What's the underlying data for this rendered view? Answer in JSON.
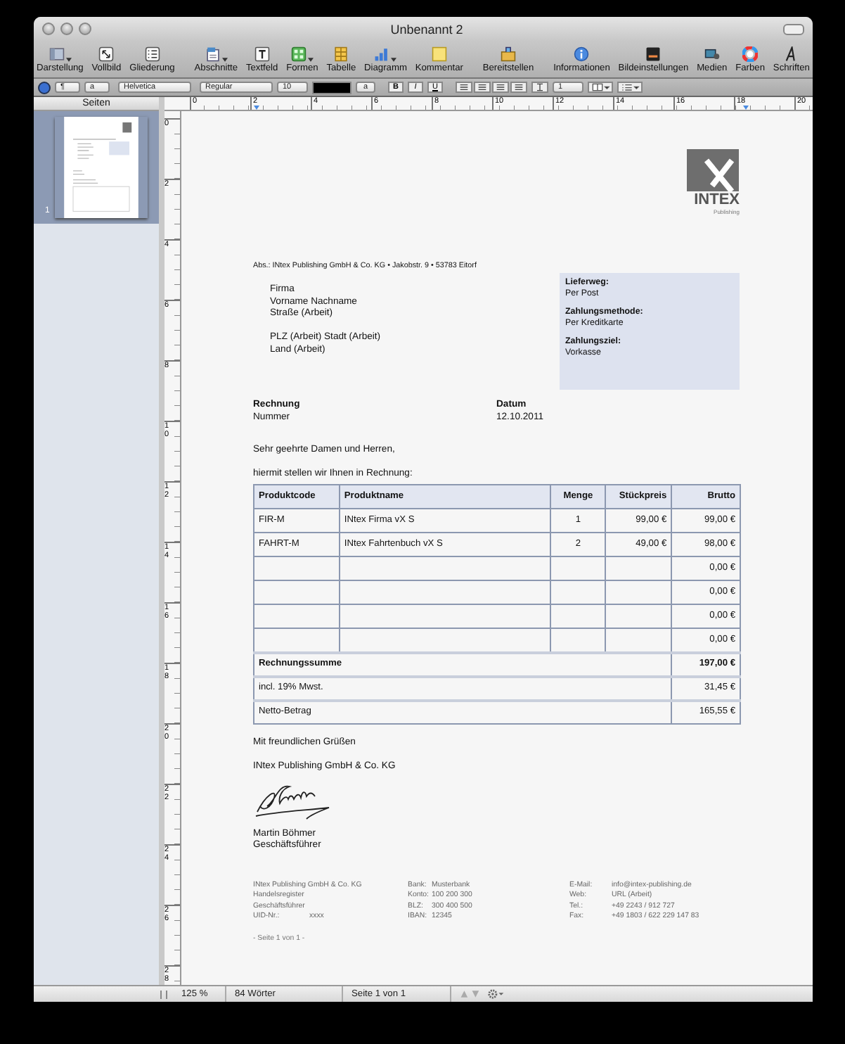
{
  "window": {
    "title": "Unbenannt 2"
  },
  "toolbar": {
    "items": [
      {
        "label": "Darstellung",
        "has_menu": true
      },
      {
        "label": "Vollbild",
        "has_menu": false
      },
      {
        "label": "Gliederung",
        "has_menu": false
      },
      {
        "label": "Abschnitte",
        "has_menu": true
      },
      {
        "label": "Textfeld",
        "has_menu": false
      },
      {
        "label": "Formen",
        "has_menu": true
      },
      {
        "label": "Tabelle",
        "has_menu": false
      },
      {
        "label": "Diagramm",
        "has_menu": true
      },
      {
        "label": "Kommentar",
        "has_menu": false
      },
      {
        "label": "Bereitstellen",
        "has_menu": false
      },
      {
        "label": "Informationen",
        "has_menu": false
      },
      {
        "label": "Bildeinstellungen",
        "has_menu": false
      },
      {
        "label": "Medien",
        "has_menu": false
      },
      {
        "label": "Farben",
        "has_menu": false
      },
      {
        "label": "Schriften",
        "has_menu": false
      }
    ]
  },
  "format_bar": {
    "paragraph_style": "¶",
    "character_style": "a",
    "font": "Helvetica",
    "typeface": "Regular",
    "size": "10",
    "highlight": "a",
    "styles": [
      "B",
      "I",
      "U"
    ],
    "line_spacing": "1"
  },
  "sidebar": {
    "title": "Seiten",
    "pages": [
      {
        "number": "1",
        "selected": true
      }
    ]
  },
  "ruler": {
    "horizontal": [
      "0",
      "2",
      "4",
      "6",
      "8",
      "10",
      "12",
      "14",
      "16",
      "18",
      "20"
    ],
    "vertical": [
      "0",
      "2",
      "4",
      "6",
      "8",
      "10",
      "12",
      "14",
      "16",
      "18",
      "20",
      "22",
      "24",
      "26",
      "28"
    ]
  },
  "document": {
    "logo": {
      "name": "INTEX",
      "tagline": "Publishing"
    },
    "sender_line": "Abs.: INtex Publishing GmbH & Co. KG • Jakobstr. 9 • 53783 Eitorf",
    "address": [
      [
        "Firma",
        "Vorname Nachname",
        "Straße (Arbeit)"
      ],
      [
        "PLZ (Arbeit) Stadt (Arbeit)",
        "Land (Arbeit)"
      ]
    ],
    "info_box": [
      {
        "label": "Lieferweg:",
        "value": "Per Post"
      },
      {
        "label": "Zahlungsmethode:",
        "value": "Per Kreditkarte"
      },
      {
        "label": "Zahlungsziel:",
        "value": "Vorkasse"
      }
    ],
    "invoice": {
      "label": "Rechnung",
      "value": "Nummer"
    },
    "date": {
      "label": "Datum",
      "value": "12.10.2011"
    },
    "salutation": "Sehr geehrte Damen und Herren,",
    "intro": "hiermit stellen wir Ihnen in Rechnung:",
    "table": {
      "columns": [
        "Produktcode",
        "Produktname",
        "Menge",
        "Stückpreis",
        "Brutto"
      ],
      "rows": [
        {
          "code": "FIR-M",
          "name": "INtex Firma vX S",
          "quantity": "1",
          "unit_price": "99,00 €",
          "gross": "99,00 €"
        },
        {
          "code": "FAHRT-M",
          "name": "INtex Fahrtenbuch vX S",
          "quantity": "2",
          "unit_price": "49,00 €",
          "gross": "98,00 €"
        },
        {
          "gross": "0,00 €"
        },
        {
          "gross": "0,00 €"
        },
        {
          "gross": "0,00 €"
        },
        {
          "gross": "0,00 €"
        }
      ],
      "summary": [
        {
          "label": "Rechnungssumme",
          "value": "197,00 €",
          "bold": true
        },
        {
          "label": "incl. 19% Mwst.",
          "value": "31,45 €",
          "bold": false
        },
        {
          "label": "Netto-Betrag",
          "value": "165,55 €",
          "bold": false
        }
      ]
    },
    "closing": "Mit freundlichen Grüßen",
    "company": "INtex Publishing GmbH & Co. KG",
    "signer": {
      "name": "Martin Böhmer",
      "title": "Geschäftsführer"
    },
    "footer": {
      "company": [
        "INtex Publishing GmbH & Co. KG",
        "Handelsregister",
        "Geschäftsführer"
      ],
      "uid": {
        "label": "UID-Nr.:",
        "value": "xxxx"
      },
      "bank": [
        {
          "label": "Bank:",
          "value": "Musterbank"
        },
        {
          "label": "Konto:",
          "value": "100 200 300"
        },
        {
          "label": "BLZ:",
          "value": "300 400 500"
        },
        {
          "label": "IBAN:",
          "value": "12345"
        }
      ],
      "contact": [
        {
          "label": "E-Mail:",
          "value": "info@intex-publishing.de"
        },
        {
          "label": "Web:",
          "value": "URL (Arbeit)"
        },
        {
          "label": "Tel.:",
          "value": "+49 2243 / 912 727"
        },
        {
          "label": "Fax:",
          "value": "+49 1803 / 622 229 147 83"
        }
      ]
    },
    "page_footer": "- Seite 1 von 1 -"
  },
  "status_bar": {
    "zoom": "125 %",
    "words": "84 Wörter",
    "page": "Seite 1 von 1"
  }
}
